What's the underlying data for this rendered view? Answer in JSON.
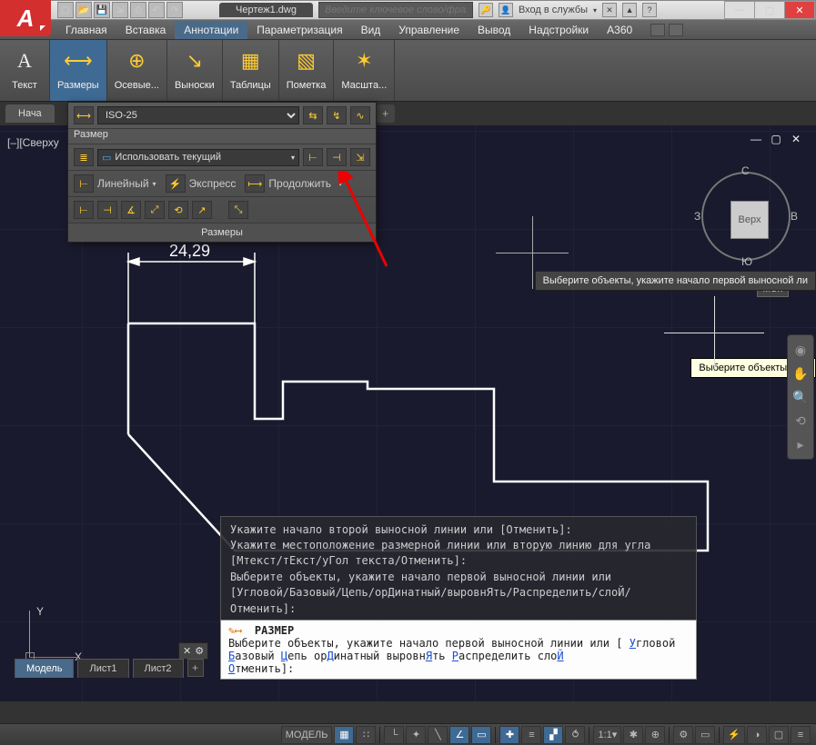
{
  "app_logo": "A",
  "document": {
    "name": "Чертеж1.dwg"
  },
  "search": {
    "placeholder": "Введите ключевое слово/фразу"
  },
  "services": {
    "login": "Вход в службы"
  },
  "menu": {
    "items": [
      "Главная",
      "Вставка",
      "Аннотации",
      "Параметризация",
      "Вид",
      "Управление",
      "Вывод",
      "Надстройки",
      "A360"
    ],
    "active_index": 2
  },
  "ribbon": {
    "groups": [
      {
        "label": "Текст",
        "icon": "A"
      },
      {
        "label": "Размеры",
        "icon": "⟷",
        "active": true
      },
      {
        "label": "Осевые...",
        "icon": "⊕"
      },
      {
        "label": "Выноски",
        "icon": "↘"
      },
      {
        "label": "Таблицы",
        "icon": "▦"
      },
      {
        "label": "Пометка",
        "icon": "▧"
      },
      {
        "label": "Масшта...",
        "icon": "✶"
      }
    ]
  },
  "doc_tabs": {
    "start": "Нача",
    "plus": "+"
  },
  "view_label": "[–][Сверху",
  "viewcube": {
    "face": "Верх",
    "n": "С",
    "s": "Ю",
    "e": "В",
    "w": "З"
  },
  "wcs": "МСК",
  "tooltip_long": "Выберите объекты, укажите начало первой выносной ли",
  "tooltip_short": "Выберите объекты, ука",
  "dim_panel": {
    "caption": "Размер",
    "style": "ISO-25",
    "use_current": "Использовать текущий",
    "linear": "Линейный",
    "express": "Экспресс",
    "cont": "Продолжить",
    "footer": "Размеры"
  },
  "dimension": {
    "value": "24,29"
  },
  "cmd_history": {
    "l1": "Укажите начало второй выносной линии или [Отменить]:",
    "l2": "Укажите местоположение размерной линии или вторую линию для угла",
    "l3": "[Мтекст/тЕкст/уГол текста/Отменить]:",
    "l4": "Выберите объекты, укажите начало первой выносной линии или",
    "l5": "[Угловой/Базовый/Цепь/орДинатный/выровнЯть/Распределить/слоЙ/",
    "l6": "Отменить]:"
  },
  "cmd_input": {
    "name": "РАЗМЕР",
    "prompt": "Выберите объекты, укажите начало первой выносной линии или [",
    "opts": [
      "Угловой",
      "Базовый",
      "Цепь",
      "орДинатный",
      "выровнЯть",
      "Распределить",
      "слоЙ",
      "Отменить"
    ],
    "end": "]:"
  },
  "ucs": {
    "x": "X",
    "y": "Y"
  },
  "layout_tabs": {
    "items": [
      "Модель",
      "Лист1",
      "Лист2"
    ],
    "active_index": 0
  },
  "status": {
    "model": "МОДЕЛЬ",
    "scale": "1:1"
  }
}
